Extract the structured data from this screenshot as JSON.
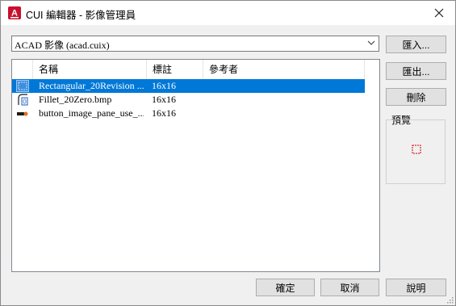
{
  "window": {
    "title": "CUI 編輯器 - 影像管理員",
    "app_icon_letter": "A"
  },
  "combo": {
    "value": "ACAD 影像 (acad.cuix)"
  },
  "buttons": {
    "import": "匯入...",
    "export": "匯出...",
    "delete": "刪除",
    "ok": "確定",
    "cancel": "取消",
    "help": "說明"
  },
  "preview": {
    "label": "預覽"
  },
  "table": {
    "headers": {
      "name": "名稱",
      "tag": "標註",
      "ref": "參考者"
    },
    "rows": [
      {
        "name": "Rectangular_20Revision ...",
        "tag": "16x16",
        "ref": "",
        "icon": "rectangle-revision-icon",
        "selected": true
      },
      {
        "name": "Fillet_20Zero.bmp",
        "tag": "16x16",
        "ref": "",
        "icon": "fillet-zero-icon",
        "selected": false
      },
      {
        "name": "button_image_pane_use_...",
        "tag": "16x16",
        "ref": "",
        "icon": "button-image-pane-icon",
        "selected": false
      }
    ]
  },
  "colors": {
    "selection": "#0078d7",
    "app_icon": "#c8102e",
    "preview_mark": "#d40000"
  }
}
